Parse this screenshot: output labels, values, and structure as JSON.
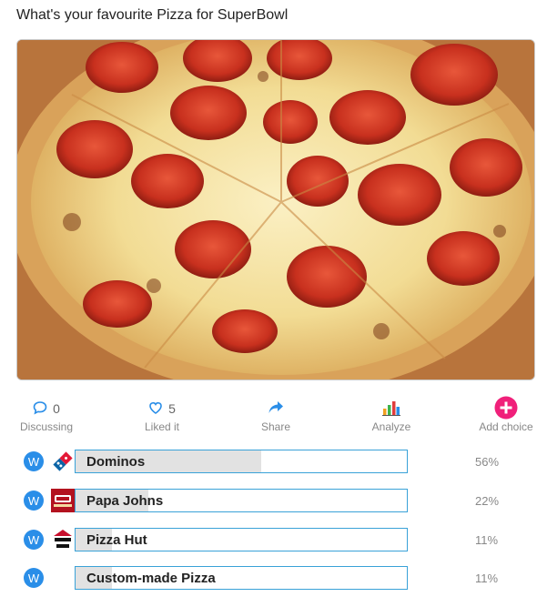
{
  "poll": {
    "title": "What's your favourite Pizza for SuperBowl"
  },
  "actions": {
    "discussing": {
      "count": "0",
      "label": "Discussing"
    },
    "liked": {
      "count": "5",
      "label": "Liked it"
    },
    "share": {
      "label": "Share"
    },
    "analyze": {
      "label": "Analyze"
    },
    "add_choice": {
      "label": "Add choice"
    }
  },
  "choices": [
    {
      "badge": "W",
      "name": "Dominos",
      "percent": "56%",
      "value": 0.56,
      "logo": "dominos-logo"
    },
    {
      "badge": "W",
      "name": "Papa Johns",
      "percent": "22%",
      "value": 0.22,
      "logo": "papa-johns-logo"
    },
    {
      "badge": "W",
      "name": "Pizza Hut",
      "percent": "11%",
      "value": 0.11,
      "logo": "pizza-hut-logo"
    },
    {
      "badge": "W",
      "name": "Custom-made Pizza",
      "percent": "11%",
      "value": 0.11,
      "logo": ""
    }
  ],
  "colors": {
    "accent": "#2a8ee8",
    "bar_border": "#39a2d8",
    "bar_fill": "#e2e2e2",
    "add_choice": "#f0207a"
  }
}
